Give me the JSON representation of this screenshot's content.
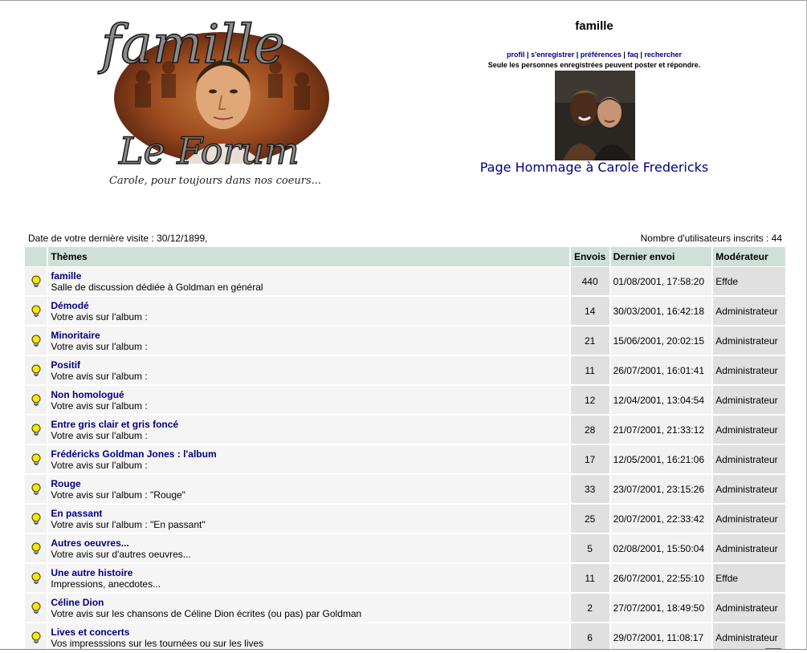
{
  "logo": {
    "word_top": "famille",
    "word_bottom": "Le Forum",
    "caption": "Carole, pour toujours dans nos coeurs..."
  },
  "header": {
    "title": "famille",
    "links": [
      "profil",
      "s'enregistrer",
      "préférences",
      "faq",
      "rechercher"
    ],
    "notice": "Seule les personnes enregistrées peuvent poster et répondre.",
    "hommage_link": "Page Hommage à Carole Fredericks"
  },
  "info": {
    "last_visit": "Date de votre dernière visite : 30/12/1899,",
    "user_count": "Nombre d'utilisateurs inscrits : 44"
  },
  "table": {
    "headers": {
      "themes": "Thèmes",
      "envois": "Envois",
      "dernier": "Dernier envoi",
      "moderateur": "Modérateur"
    },
    "rows": [
      {
        "name": "famille",
        "desc": "Salle de discussion dédiée à Goldman en général",
        "envois": "440",
        "dernier": "01/08/2001, 17:58:20",
        "moderateur": "Effde"
      },
      {
        "name": "Démodé",
        "desc": "Votre avis sur l'album :",
        "envois": "14",
        "dernier": "30/03/2001, 16:42:18",
        "moderateur": "Administrateur"
      },
      {
        "name": "Minoritaire",
        "desc": "Votre avis sur l'album :",
        "envois": "21",
        "dernier": "15/06/2001, 20:02:15",
        "moderateur": "Administrateur"
      },
      {
        "name": "Positif",
        "desc": "Votre avis sur l'album :",
        "envois": "11",
        "dernier": "26/07/2001, 16:01:41",
        "moderateur": "Administrateur"
      },
      {
        "name": "Non homologué",
        "desc": "Votre avis sur l'album :",
        "envois": "12",
        "dernier": "12/04/2001, 13:04:54",
        "moderateur": "Administrateur"
      },
      {
        "name": "Entre gris clair et gris foncé",
        "desc": "Votre avis sur l'album :",
        "envois": "28",
        "dernier": "21/07/2001, 21:33:12",
        "moderateur": "Administrateur"
      },
      {
        "name": "Frédéricks Goldman Jones : l'album",
        "desc": "Votre avis sur l'album :",
        "envois": "17",
        "dernier": "12/05/2001, 16:21:06",
        "moderateur": "Administrateur"
      },
      {
        "name": "Rouge",
        "desc": "Votre avis sur l'album : \"Rouge\"",
        "envois": "33",
        "dernier": "23/07/2001, 23:15:26",
        "moderateur": "Administrateur"
      },
      {
        "name": "En passant",
        "desc": "Votre avis sur l'album : \"En passant\"",
        "envois": "25",
        "dernier": "20/07/2001, 22:33:42",
        "moderateur": "Administrateur"
      },
      {
        "name": "Autres oeuvres...",
        "desc": "Votre avis sur d'autres oeuvres...",
        "envois": "5",
        "dernier": "02/08/2001, 15:50:04",
        "moderateur": "Administrateur"
      },
      {
        "name": "Une autre histoire",
        "desc": "Impressions, anecdotes...",
        "envois": "11",
        "dernier": "26/07/2001, 22:55:10",
        "moderateur": "Effde"
      },
      {
        "name": "Céline Dion",
        "desc": "Votre avis sur les chansons de Céline Dion écrites (ou pas) par Goldman",
        "envois": "2",
        "dernier": "27/07/2001, 18:49:50",
        "moderateur": "Administrateur"
      },
      {
        "name": "Lives et concerts",
        "desc": "Vos impresssions sur les tournées ou sur les lives",
        "envois": "6",
        "dernier": "29/07/2001, 11:08:17",
        "moderateur": "Administrateur"
      }
    ]
  },
  "colors": {
    "link": "#000080",
    "header_bg": "#cfe0d8",
    "cell_light": "#f2f2f2",
    "cell_dark": "#e0e0e0",
    "bulb": "#ffe600"
  },
  "icons": {
    "forum_status": "lightbulb-icon"
  }
}
